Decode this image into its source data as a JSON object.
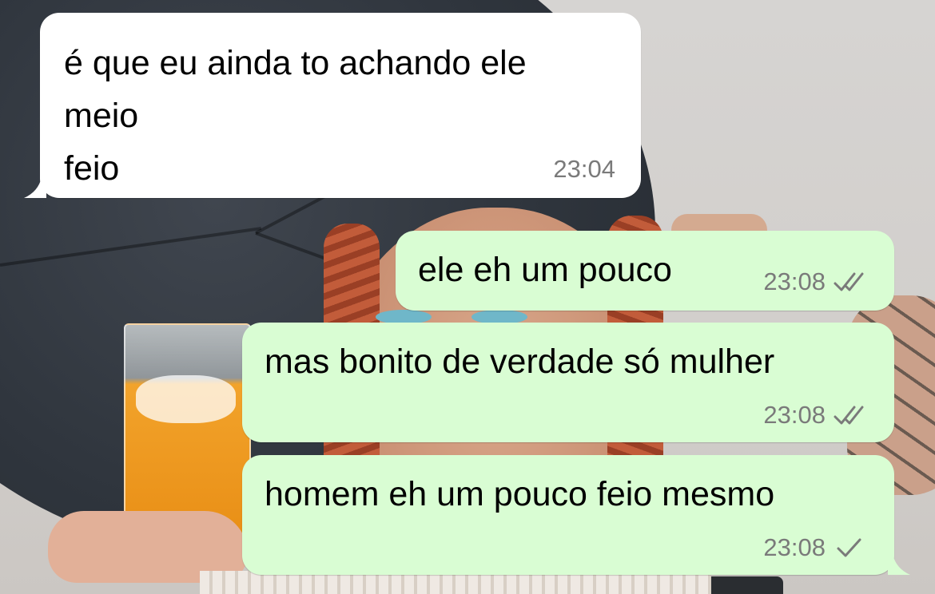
{
  "messages": [
    {
      "direction": "incoming",
      "text": "é que eu ainda to achando ele\nmeio\nfeio",
      "time": "23:04"
    },
    {
      "direction": "outgoing",
      "text": "ele eh um pouco",
      "time": "23:08",
      "status_icon": "double-check-icon"
    },
    {
      "direction": "outgoing",
      "text": "mas bonito de verdade só mulher",
      "time": "23:08",
      "status_icon": "double-check-icon"
    },
    {
      "direction": "outgoing",
      "text": "homem eh um pouco feio mesmo",
      "time": "23:08",
      "status_icon": "single-check-icon"
    }
  ],
  "colors": {
    "incoming_bubble": "#ffffff",
    "outgoing_bubble": "#d9fdd3",
    "meta_text": "#7a7a7a"
  }
}
